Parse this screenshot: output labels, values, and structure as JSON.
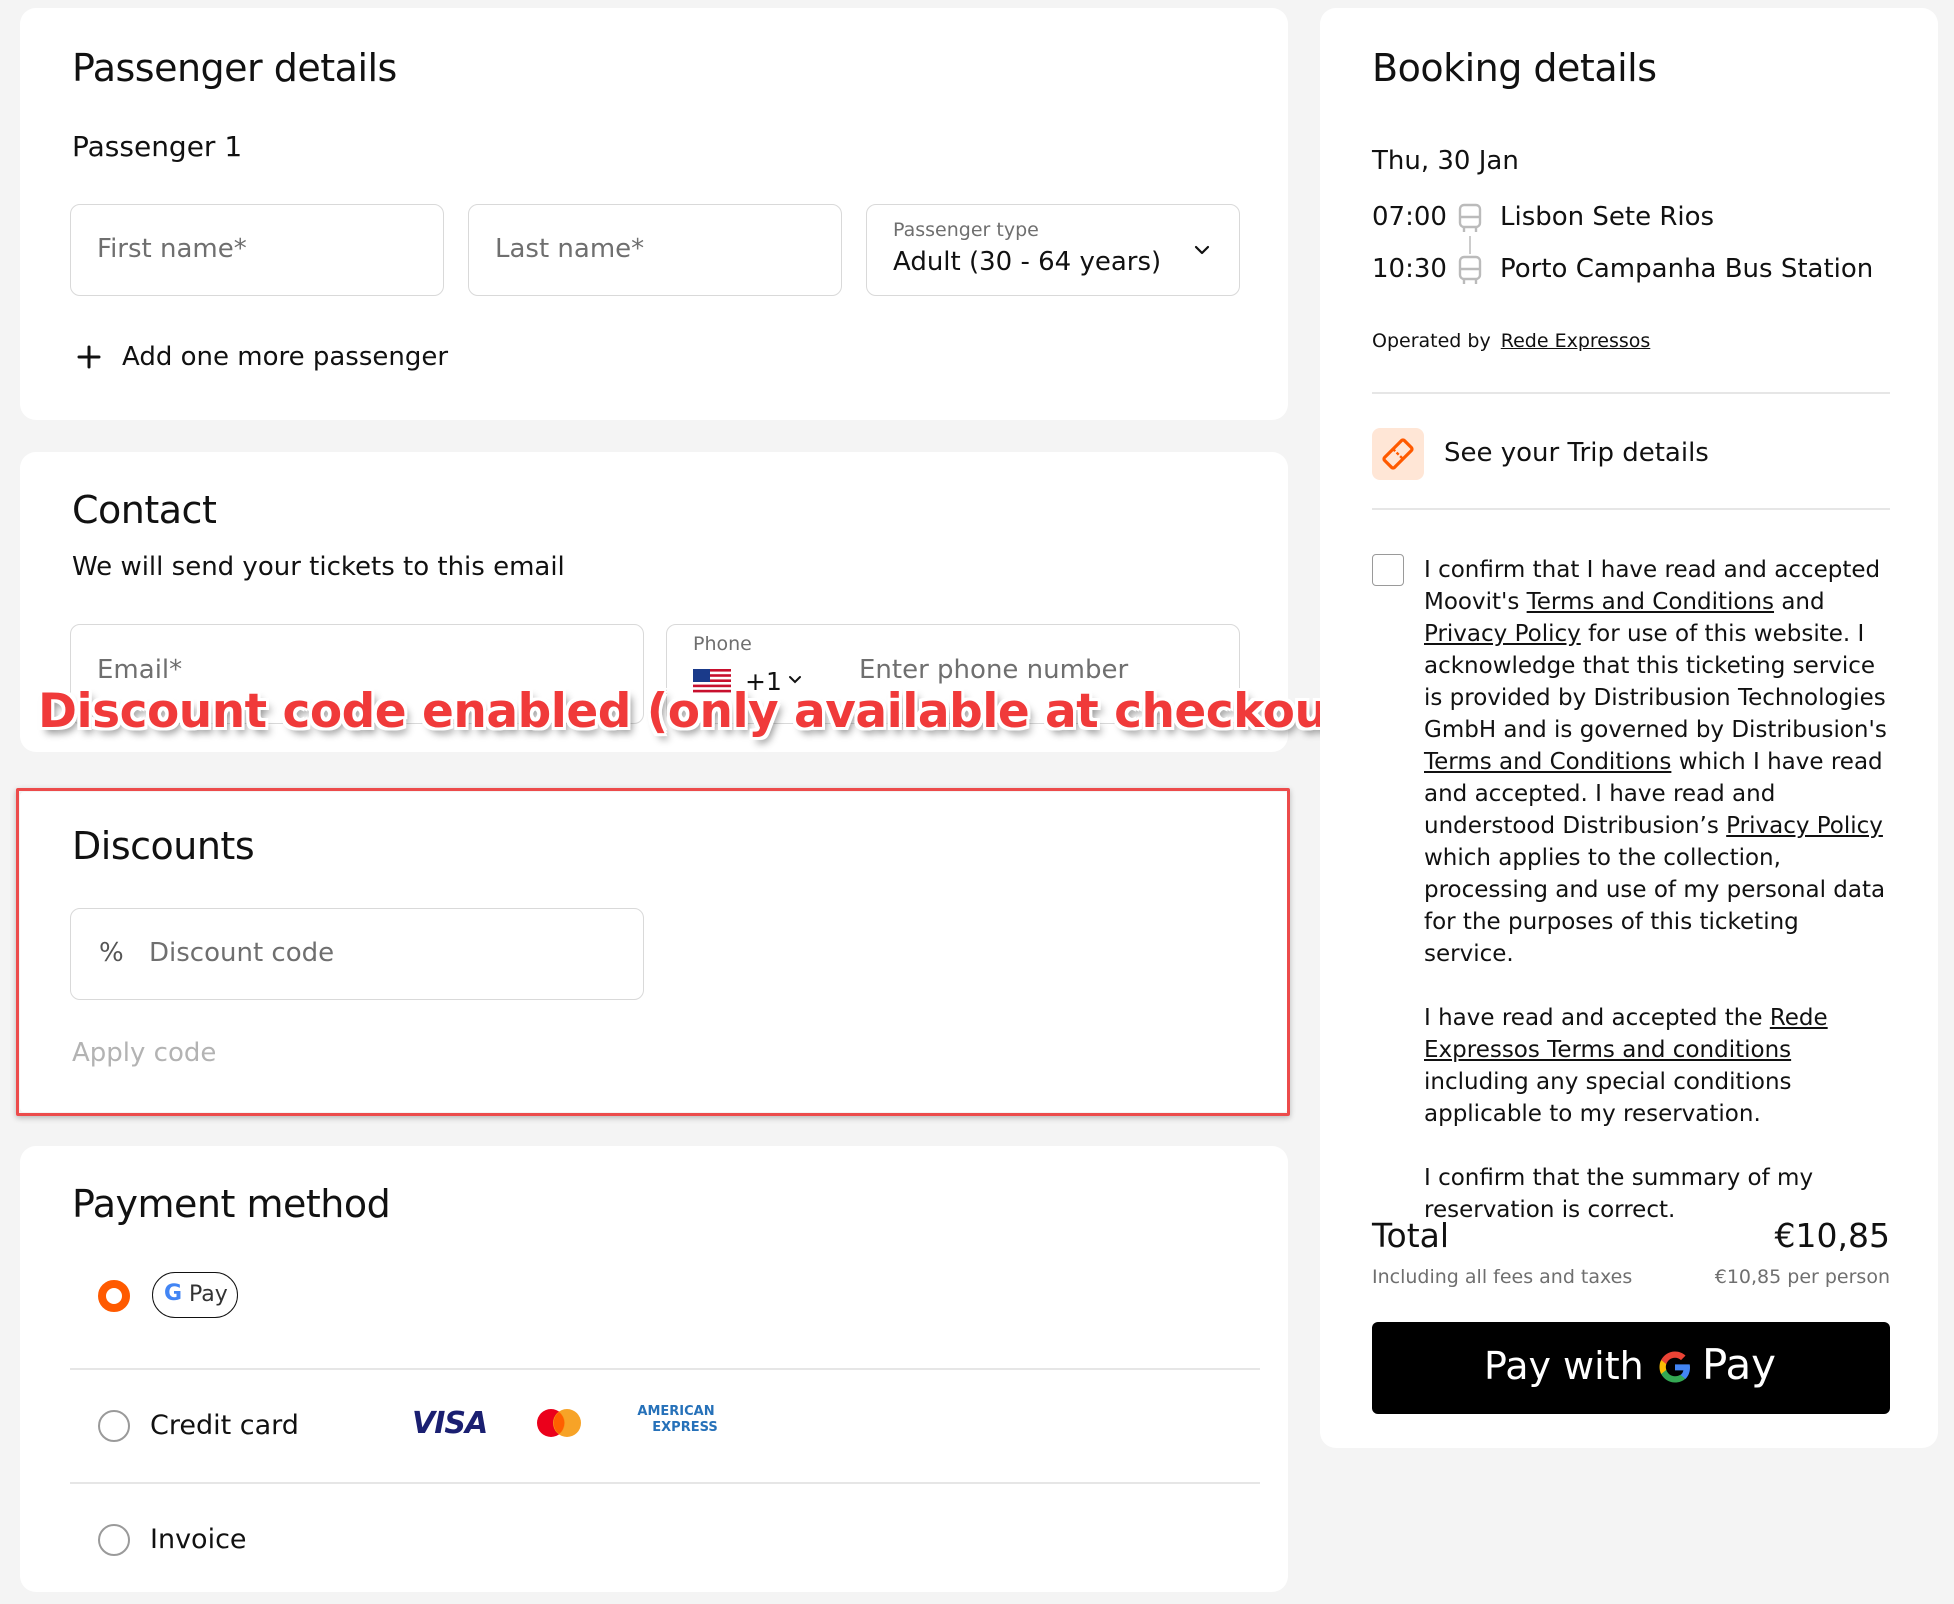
{
  "passenger": {
    "title": "Passenger details",
    "subtitle": "Passenger 1",
    "first_name_placeholder": "First name*",
    "last_name_placeholder": "Last name*",
    "type_label": "Passenger type",
    "type_value": "Adult (30 - 64 years)",
    "add_more": "Add one more passenger"
  },
  "contact": {
    "title": "Contact",
    "subtitle": "We will send your tickets to this email",
    "email_placeholder": "Email*",
    "phone_label": "Phone",
    "phone_code": "+1",
    "phone_placeholder": "Enter phone number"
  },
  "annotation": "Discount code enabled (only available at checkout)",
  "discounts": {
    "title": "Discounts",
    "percent_symbol": "%",
    "code_placeholder": "Discount code",
    "apply": "Apply code"
  },
  "payment": {
    "title": "Payment method",
    "gpay_badge": "Pay",
    "credit_card": "Credit card",
    "visa": "VISA",
    "amex_line1": "AMERICAN",
    "amex_line2": "EXPRESS",
    "invoice": "Invoice"
  },
  "booking": {
    "title": "Booking details",
    "date": "Thu, 30 Jan",
    "dep_time": "07:00",
    "dep_station": "Lisbon Sete Rios",
    "arr_time": "10:30",
    "arr_station": "Porto Campanha Bus Station",
    "operated_by": "Operated by",
    "operator": "Rede Expressos",
    "trip_details": "See your Trip details",
    "terms": {
      "t1": "I confirm that I have read and accepted Moovit's",
      "l1": "Terms and Conditions",
      "t2": "and",
      "l2": "Privacy Policy",
      "t3": "for use of this website. I acknowledge that this ticketing service is provided by Distribusion Technologies GmbH and is governed by Distribusion's",
      "l3": "Terms and Conditions",
      "t4": "which I have read and accepted. I have read and understood Distribusion’s",
      "l4": "Privacy Policy",
      "t5": "which applies to the collection, processing and use of my personal data for the purposes of this ticketing service.",
      "p2a": "I have read and accepted the",
      "p2l": "Rede Expressos Terms and conditions",
      "p2b": "including any special conditions applicable to my reservation.",
      "p3": "I confirm that the summary of my reservation is correct."
    },
    "total_label": "Total",
    "total_value": "€10,85",
    "fees_note": "Including all fees and taxes",
    "per_person": "€10,85 per person",
    "pay_with": "Pay with",
    "pay_word": "Pay"
  },
  "colors": {
    "accent": "#ff5a00",
    "annotation_red": "#f03a3a",
    "pay_button_bg": "#000000"
  }
}
